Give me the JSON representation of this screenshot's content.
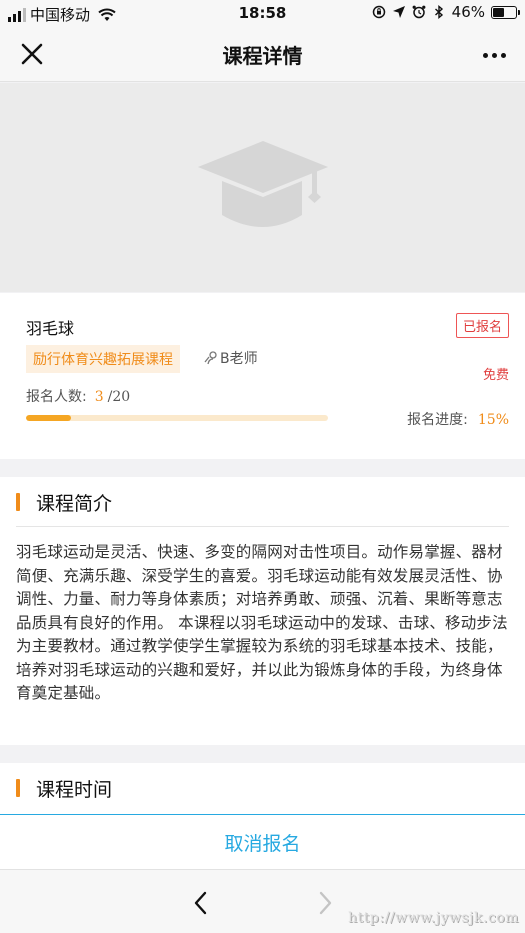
{
  "status_bar": {
    "carrier": "中国移动",
    "time": "18:58",
    "battery": "46%",
    "battery_level": 0.46
  },
  "nav": {
    "title": "课程详情",
    "close_icon": "close-icon",
    "more_icon": "more-icon"
  },
  "cover": {
    "icon": "graduation-cap-icon"
  },
  "course": {
    "name": "羽毛球",
    "status": "已报名",
    "category": "励行体育兴趣拓展课程",
    "teacher": "B老师",
    "price": "免费",
    "enroll_label": "报名人数:",
    "enroll_current": "3",
    "enroll_total": "/20",
    "progress_label": "报名进度:",
    "progress_pct": "15%",
    "progress_value": 0.15
  },
  "intro": {
    "title": "课程简介",
    "text": "羽毛球运动是灵活、快速、多变的隔网对击性项目。动作易掌握、器材简便、充满乐趣、深受学生的喜爱。羽毛球运动能有效发展灵活性、协调性、力量、耐力等身体素质；对培养勇敢、顽强、沉着、果断等意志品质具有良好的作用。 本课程以羽毛球运动中的发球、击球、移动步法为主要教材。通过教学使学生掌握较为系统的羽毛球基本技术、技能，培养对羽毛球运动的兴趣和爱好，并以此为锻炼身体的手段，为终身体育奠定基础。"
  },
  "schedule": {
    "title": "课程时间"
  },
  "action": {
    "cancel_label": "取消报名"
  },
  "browser": {
    "back_icon": "chevron-left-icon",
    "forward_icon": "chevron-right-icon",
    "watermark": "http://www.jywsjk.com"
  },
  "colors": {
    "accent": "#f08c1a",
    "link": "#27a9e1",
    "danger": "#e03e3e"
  }
}
